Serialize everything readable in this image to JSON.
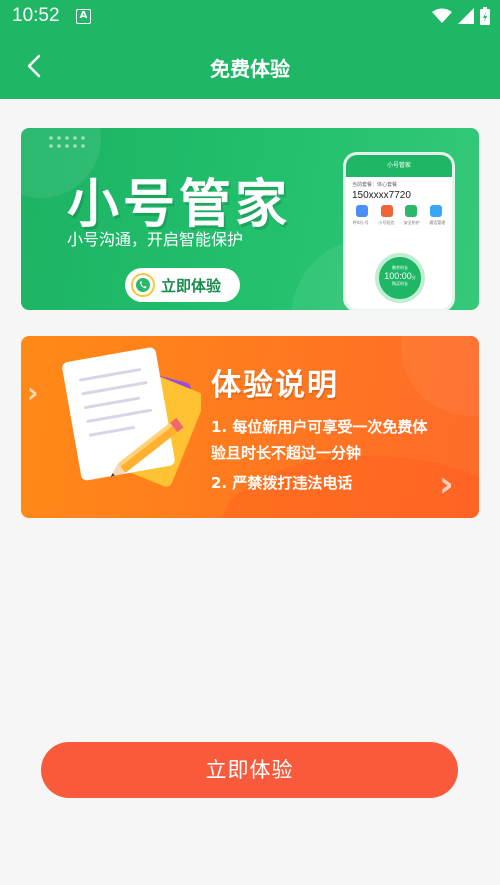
{
  "status_bar": {
    "time": "10:52",
    "notification_badge": "A"
  },
  "app_bar": {
    "title": "免费体验"
  },
  "green_banner": {
    "title": "小号管家",
    "subtitle": "小号沟通，开启智能保护",
    "button_label": "立即体验",
    "phone": {
      "app_title": "小号管家",
      "user_line": "当前套餐：体心套餐",
      "number": "150xxxx7720",
      "features": [
        "呼叫小号",
        "小号短信",
        "安全防护",
        "通话管理"
      ],
      "circle_top": "剩余时长",
      "circle_value": "100:00",
      "circle_unit": "分",
      "circle_bottom": "购买时长"
    }
  },
  "orange_banner": {
    "title": "体验说明",
    "line1": "1. 每位新用户可享受一次免费体",
    "line2": "验且时长不超过一分钟",
    "line3": "2. 严禁拨打违法电话"
  },
  "cta_button": {
    "label": "立即体验"
  },
  "colors": {
    "primary_green": "#1fb766",
    "orange": "#ff7a1f",
    "cta_red": "#fa5a3c"
  }
}
